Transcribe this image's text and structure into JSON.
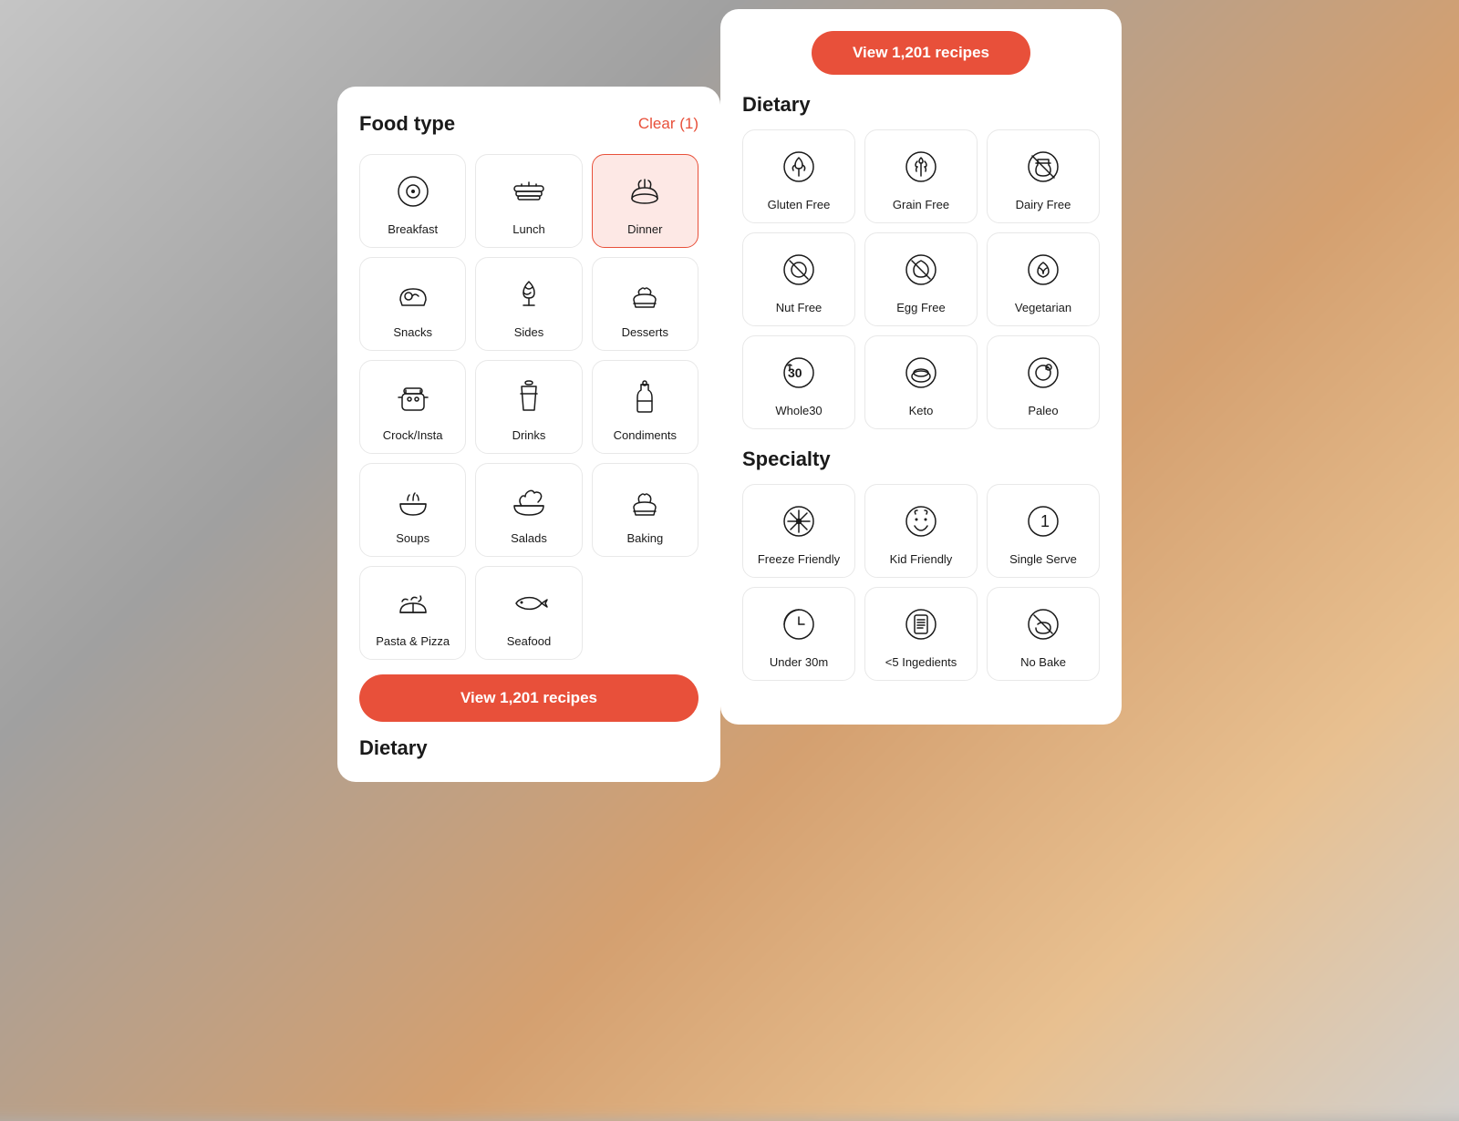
{
  "background": {
    "description": "blurred kitchen background"
  },
  "left_panel": {
    "title": "Food type",
    "clear_button": "Clear (1)",
    "food_items": [
      {
        "id": "breakfast",
        "label": "Breakfast",
        "selected": false
      },
      {
        "id": "lunch",
        "label": "Lunch",
        "selected": false
      },
      {
        "id": "dinner",
        "label": "Dinner",
        "selected": true
      },
      {
        "id": "snacks",
        "label": "Snacks",
        "selected": false
      },
      {
        "id": "sides",
        "label": "Sides",
        "selected": false
      },
      {
        "id": "desserts",
        "label": "Desserts",
        "selected": false
      },
      {
        "id": "crock-insta",
        "label": "Crock/Insta",
        "selected": false
      },
      {
        "id": "drinks",
        "label": "Drinks",
        "selected": false
      },
      {
        "id": "condiments",
        "label": "Condiments",
        "selected": false
      },
      {
        "id": "soups",
        "label": "Soups",
        "selected": false
      },
      {
        "id": "salads",
        "label": "Salads",
        "selected": false
      },
      {
        "id": "baking",
        "label": "Baking",
        "selected": false
      },
      {
        "id": "pasta-pizza",
        "label": "Pasta & Pizza",
        "selected": false
      },
      {
        "id": "seafood",
        "label": "Seafood",
        "selected": false
      }
    ],
    "view_button": "View 1,201 recipes",
    "dietary_title": "Dietary"
  },
  "right_panel": {
    "view_button": "View 1,201 recipes",
    "dietary_title": "Dietary",
    "dietary_items": [
      {
        "id": "gluten-free",
        "label": "Gluten Free"
      },
      {
        "id": "grain-free",
        "label": "Grain Free"
      },
      {
        "id": "dairy-free",
        "label": "Dairy Free"
      },
      {
        "id": "nut-free",
        "label": "Nut Free"
      },
      {
        "id": "egg-free",
        "label": "Egg Free"
      },
      {
        "id": "vegetarian",
        "label": "Vegetarian"
      },
      {
        "id": "whole30",
        "label": "Whole30"
      },
      {
        "id": "keto",
        "label": "Keto"
      },
      {
        "id": "paleo",
        "label": "Paleo"
      }
    ],
    "specialty_title": "Specialty",
    "specialty_items": [
      {
        "id": "freeze-friendly",
        "label": "Freeze Friendly"
      },
      {
        "id": "kid-friendly",
        "label": "Kid Friendly"
      },
      {
        "id": "single-serve",
        "label": "Single Serve"
      },
      {
        "id": "under-30m",
        "label": "Under 30m"
      },
      {
        "id": "5-ingredients",
        "label": "<5 Ingedients"
      },
      {
        "id": "no-bake",
        "label": "No Bake"
      }
    ]
  }
}
